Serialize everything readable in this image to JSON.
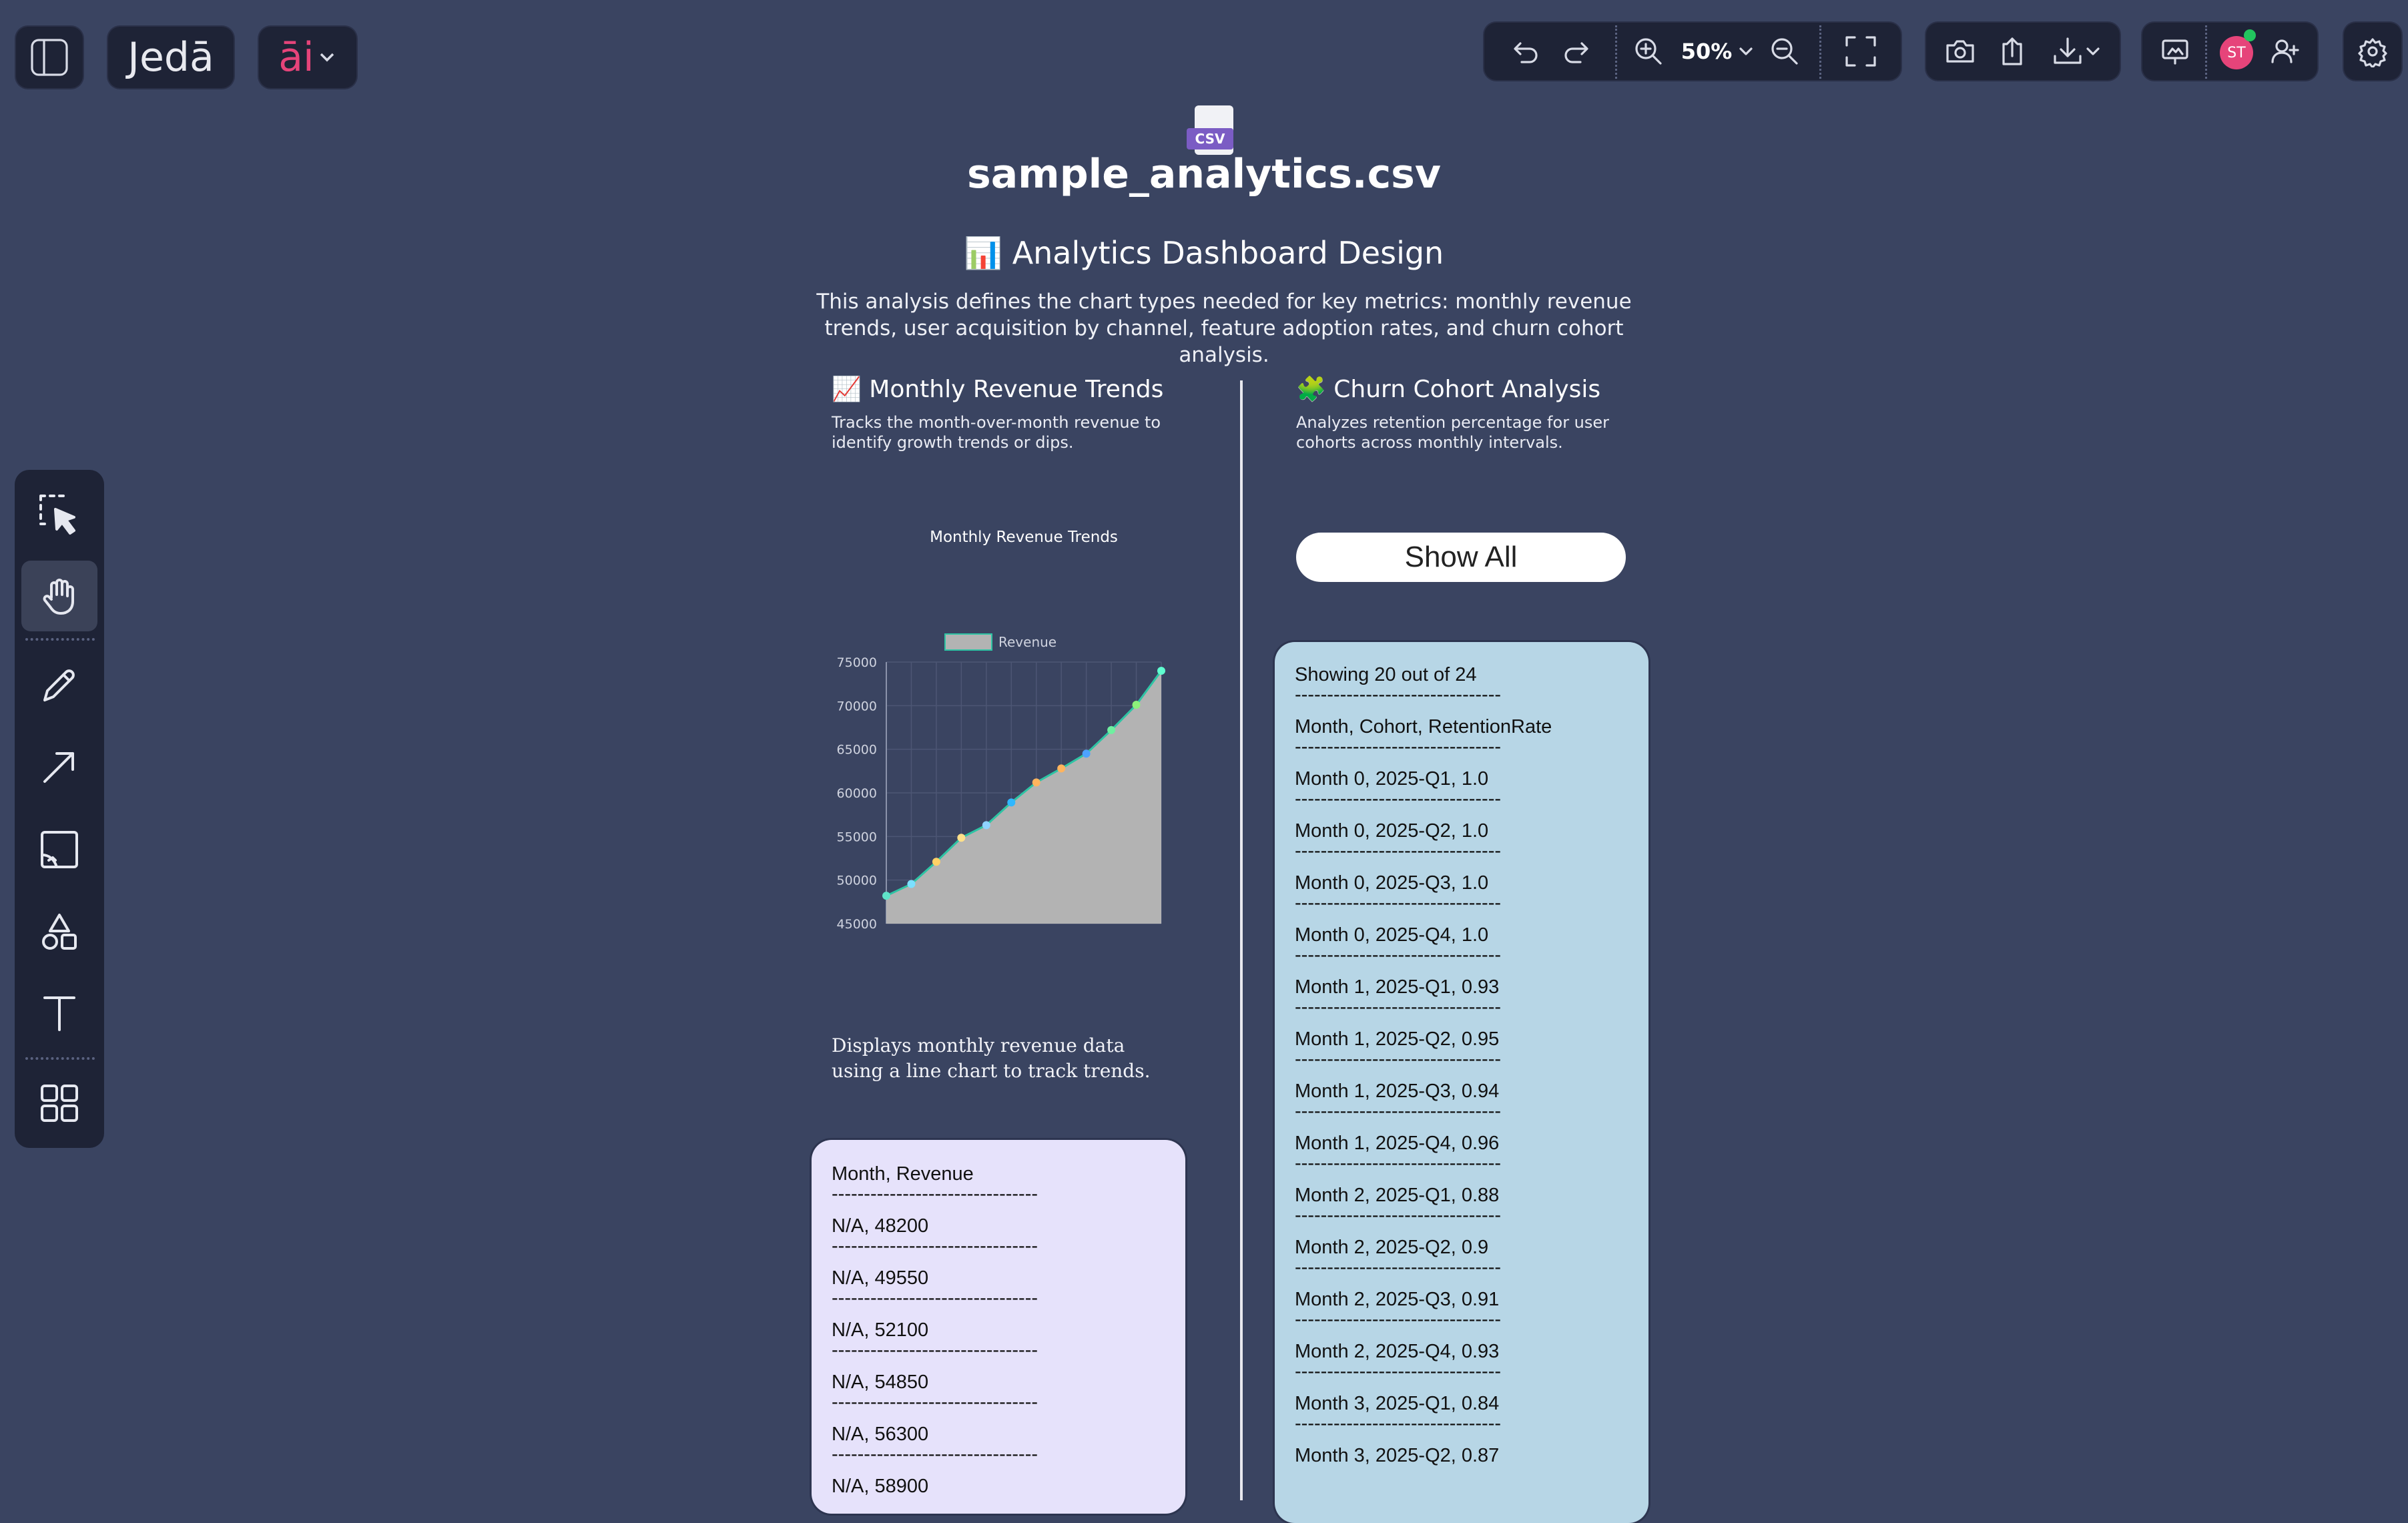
{
  "app": {
    "logo_text": "Jedā",
    "ai_logo_text": "āi",
    "zoom_label": "50%",
    "avatar_initials": "ST"
  },
  "colors": {
    "background": "#3a4461",
    "toolbar_bg": "#1e2336",
    "accent_pink": "#e6447a",
    "revenue_card_bg": "#e6e2fb",
    "cohort_card_bg": "#b7d6e6",
    "chart_fill": "#b3b3b3",
    "chart_line": "#2ec4a4"
  },
  "file": {
    "icon_label": "CSV",
    "name": "sample_analytics.csv"
  },
  "dashboard": {
    "heading_icon": "📊",
    "heading": "Analytics Dashboard Design",
    "description": "This analysis defines the chart types needed for key metrics: monthly revenue trends, user acquisition by channel, feature adoption rates, and churn cohort analysis."
  },
  "revenue_section": {
    "icon": "📈",
    "title": "Monthly Revenue Trends",
    "subtitle": "Tracks the month-over-month revenue to identify growth trends or dips.",
    "chart_description": "Displays monthly revenue data using a line chart to track trends.",
    "table_header": "Month, Revenue",
    "divider": "--------------------------------",
    "rows": [
      "N/A, 48200",
      "N/A, 49550",
      "N/A, 52100",
      "N/A, 54850",
      "N/A, 56300",
      "N/A, 58900"
    ]
  },
  "chart_data": {
    "type": "area",
    "title": "Monthly Revenue Trends",
    "legend": [
      "Revenue"
    ],
    "legend_position": "top",
    "xlabel": "",
    "ylabel": "",
    "ylim": [
      45000,
      75000
    ],
    "yticks": [
      75000,
      70000,
      65000,
      60000,
      55000,
      50000,
      45000
    ],
    "grid": true,
    "series": [
      {
        "name": "Revenue",
        "values": [
          48200,
          49550,
          52100,
          54850,
          56300,
          58900,
          61200,
          62800,
          64500,
          67200,
          70100,
          74000
        ]
      }
    ]
  },
  "churn_section": {
    "icon": "🧩",
    "title": "Churn Cohort Analysis",
    "subtitle": "Analyzes retention percentage for user cohorts across monthly intervals.",
    "show_all_label": "Show All",
    "count_text": "Showing 20 out of 24",
    "table_header": "Month, Cohort, RetentionRate",
    "divider": "--------------------------------",
    "rows": [
      "Month 0, 2025-Q1, 1.0",
      "Month 0, 2025-Q2, 1.0",
      "Month 0, 2025-Q3, 1.0",
      "Month 0, 2025-Q4, 1.0",
      "Month 1, 2025-Q1, 0.93",
      "Month 1, 2025-Q2, 0.95",
      "Month 1, 2025-Q3, 0.94",
      "Month 1, 2025-Q4, 0.96",
      "Month 2, 2025-Q1, 0.88",
      "Month 2, 2025-Q2, 0.9",
      "Month 2, 2025-Q3, 0.91",
      "Month 2, 2025-Q4, 0.93",
      "Month 3, 2025-Q1, 0.84",
      "Month 3, 2025-Q2, 0.87"
    ]
  },
  "icons": {
    "sidebar_toggle": "sidebar-toggle-icon",
    "undo": "undo-icon",
    "redo": "redo-icon",
    "zoom_in": "zoom-in-icon",
    "zoom_out": "zoom-out-icon",
    "fit": "fit-screen-icon",
    "camera": "camera-icon",
    "share": "share-icon",
    "download": "download-icon",
    "present": "present-icon",
    "add_user": "add-user-icon",
    "settings": "gear-icon"
  }
}
